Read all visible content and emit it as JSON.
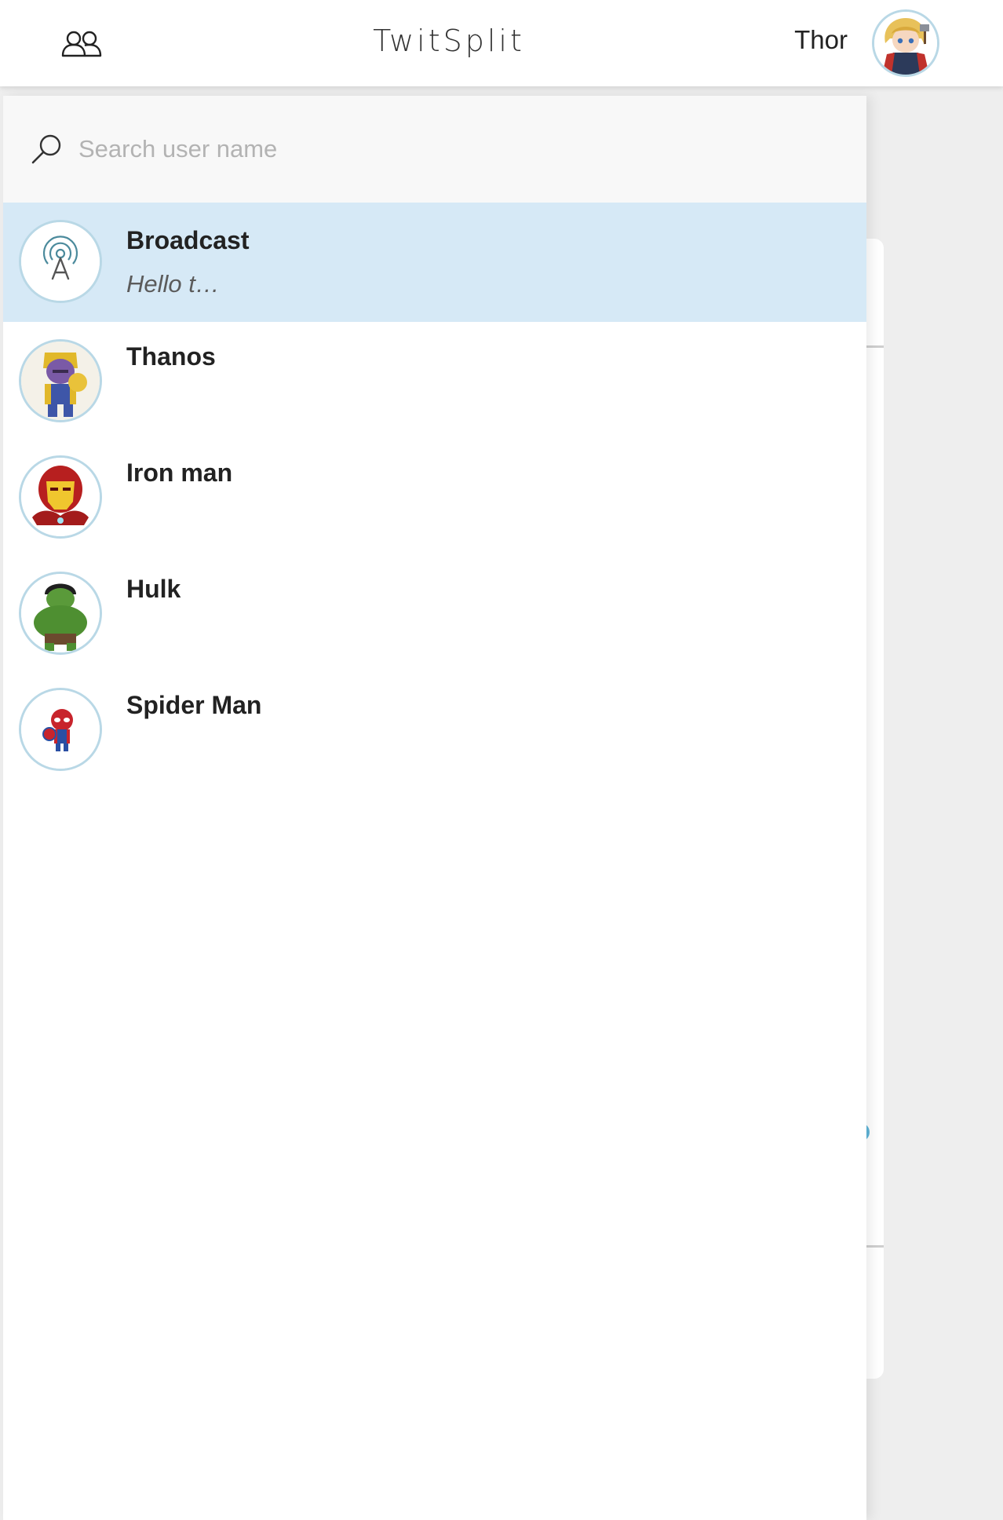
{
  "header": {
    "users_icon": "users-icon",
    "title": "TwitSplit",
    "user_name": "Thor",
    "user_avatar": "thor-avatar"
  },
  "search": {
    "icon": "search-icon",
    "placeholder": "Search user name",
    "value": ""
  },
  "conversations": [
    {
      "name": "Broadcast",
      "preview": "Hello t…",
      "icon": "broadcast-tower-icon",
      "active": true
    },
    {
      "name": "Thanos",
      "preview": "",
      "icon": "thanos-avatar",
      "active": false
    },
    {
      "name": "Iron man",
      "preview": "",
      "icon": "iron-man-avatar",
      "active": false
    },
    {
      "name": "Hulk",
      "preview": "",
      "icon": "hulk-avatar",
      "active": false
    },
    {
      "name": "Spider Man",
      "preview": "",
      "icon": "spider-man-avatar",
      "active": false
    }
  ],
  "colors": {
    "active_row": "#d6e9f6",
    "avatar_border": "#b9d8e6",
    "background": "#eeeeee",
    "accent": "#5fb5d9"
  }
}
